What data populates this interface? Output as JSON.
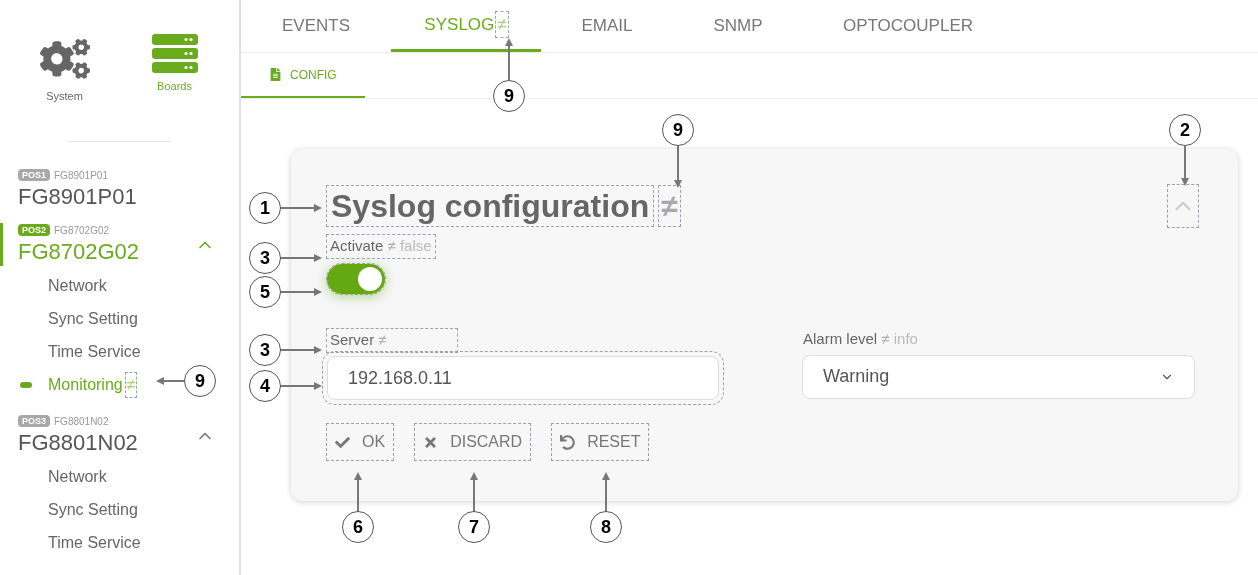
{
  "sidebar": {
    "nav": [
      {
        "kind": "system",
        "label": "System",
        "selected": false
      },
      {
        "kind": "boards",
        "label": "Boards",
        "selected": true
      }
    ],
    "boards": [
      {
        "pos": "POS1",
        "code": "FG8901P01",
        "name": "FG8901P01",
        "selected": false,
        "expanded": false
      },
      {
        "pos": "POS2",
        "code": "FG8702G02",
        "name": "FG8702G02",
        "selected": true,
        "expanded": true,
        "items": [
          {
            "label": "Network",
            "selected": false
          },
          {
            "label": "Sync Setting",
            "selected": false
          },
          {
            "label": "Time Service",
            "selected": false
          },
          {
            "label": "Monitoring",
            "selected": true,
            "mark": "≠"
          }
        ]
      },
      {
        "pos": "POS3",
        "code": "FG8801N02",
        "name": "FG8801N02",
        "selected": false,
        "expanded": true,
        "items": [
          {
            "label": "Network",
            "selected": false
          },
          {
            "label": "Sync Setting",
            "selected": false
          },
          {
            "label": "Time Service",
            "selected": false
          }
        ]
      }
    ]
  },
  "tabs": [
    {
      "label": "EVENTS",
      "selected": false
    },
    {
      "label": "SYSLOG",
      "selected": true,
      "mark": "≠"
    },
    {
      "label": "EMAIL",
      "selected": false
    },
    {
      "label": "SNMP",
      "selected": false
    },
    {
      "label": "OPTOCOUPLER",
      "selected": false
    }
  ],
  "subtabs": [
    {
      "label": "CONFIG",
      "selected": true
    }
  ],
  "card": {
    "title": "Syslog configuration",
    "title_mark": "≠",
    "expanded": true,
    "activate": {
      "label": "Activate",
      "mark": "≠",
      "default": "false",
      "on": true
    },
    "server": {
      "label": "Server",
      "mark": "≠",
      "value": "192.168.0.11"
    },
    "alarm_level": {
      "label": "Alarm level",
      "mark": "≠",
      "default": "info",
      "value": "Warning"
    },
    "buttons": [
      {
        "kind": "ok",
        "label": "OK"
      },
      {
        "kind": "discard",
        "label": "DISCARD"
      },
      {
        "kind": "reset",
        "label": "RESET"
      }
    ]
  },
  "callouts": [
    {
      "number": "9"
    },
    {
      "number": "9"
    },
    {
      "number": "2"
    },
    {
      "number": "1"
    },
    {
      "number": "3"
    },
    {
      "number": "5"
    },
    {
      "number": "3"
    },
    {
      "number": "4"
    },
    {
      "number": "9"
    },
    {
      "number": "6"
    },
    {
      "number": "7"
    },
    {
      "number": "8"
    }
  ]
}
